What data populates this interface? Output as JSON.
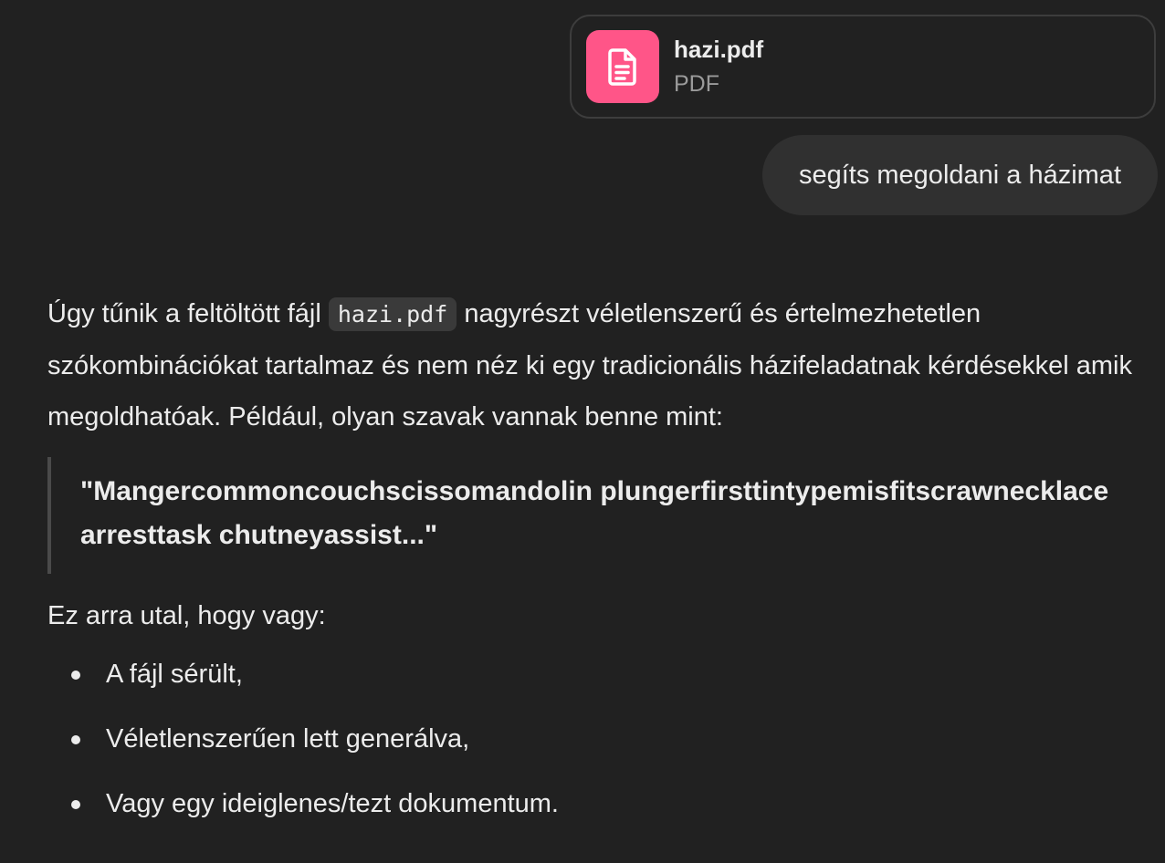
{
  "attachment": {
    "file_name": "hazi.pdf",
    "file_type": "PDF",
    "icon": "document-icon",
    "icon_bg": "#ff5588"
  },
  "user_message": "segíts megoldani a házimat",
  "response": {
    "intro_before_code": "Úgy tűnik a feltöltött fájl ",
    "intro_code": "hazi.pdf",
    "intro_after_code": " nagyrészt véletlenszerű és értelmezhetetlen szókombinációkat tartalmaz és nem néz ki egy tradicionális házifeladatnak kérdésekkel amik megoldhatóak. Például, olyan szavak vannak benne mint:",
    "quote": "\"Mangercommoncouchscissomandolin plungerfirsttintypemisfitscrawnecklace arresttask chutneyassist...\"",
    "lead_in": "Ez arra utal, hogy vagy:",
    "bullets": [
      "A fájl sérült,",
      "Véletlenszerűen lett generálva,",
      "Vagy egy ideiglenes/tezt dokumentum."
    ]
  }
}
